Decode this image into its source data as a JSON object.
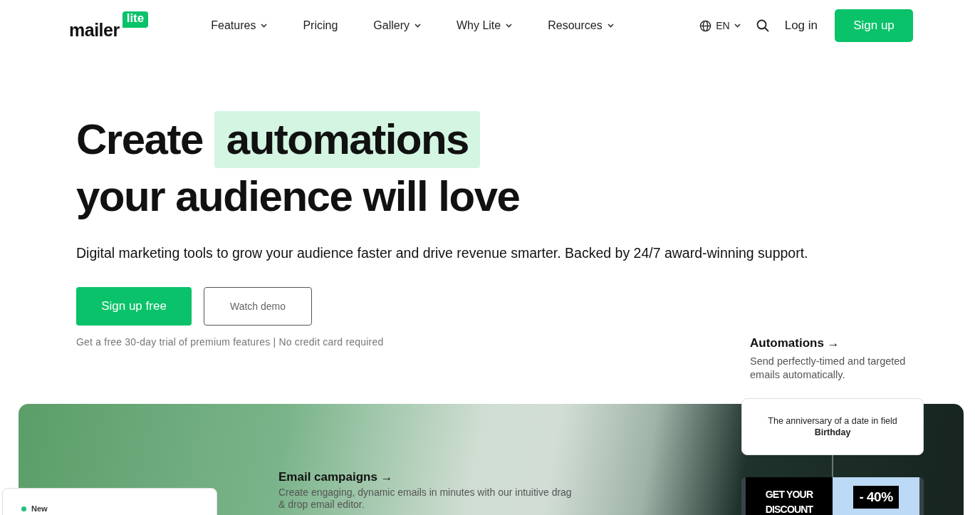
{
  "header": {
    "logo": {
      "word": "mailer",
      "badge": "lite"
    },
    "nav": [
      {
        "label": "Features",
        "dropdown": true
      },
      {
        "label": "Pricing",
        "dropdown": false
      },
      {
        "label": "Gallery",
        "dropdown": true
      },
      {
        "label": "Why Lite",
        "dropdown": true
      },
      {
        "label": "Resources",
        "dropdown": true
      }
    ],
    "language": "EN",
    "login": "Log in",
    "signup": "Sign up"
  },
  "hero": {
    "title_before": "Create",
    "title_highlight": "automations",
    "title_after": "your audience will love",
    "subtitle": "Digital marketing tools to grow your audience faster and drive revenue smarter. Backed by 24/7 award-winning support.",
    "primary_button": "Sign up free",
    "secondary_button": "Watch demo",
    "note": "Get a free 30-day trial of premium features | No credit card required"
  },
  "features": [
    {
      "title": "Automations →",
      "description": "Send perfectly-timed and targeted emails automatically."
    },
    {
      "title": "Email campaigns →",
      "description": "Create engaging, dynamic emails in minutes with our intuitive drag & drop email editor."
    }
  ],
  "showcase": {
    "trigger_card": "The anniversary of a date in field **Birthday**",
    "discount": {
      "headline": "GET YOUR DISCOUNT",
      "badge": "- 40%"
    },
    "stat_card": {
      "label": "New"
    }
  }
}
